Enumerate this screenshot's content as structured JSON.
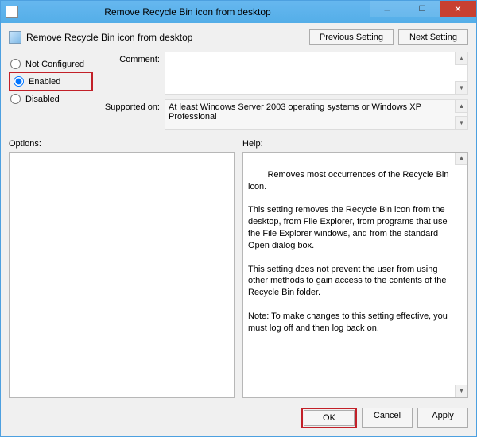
{
  "window": {
    "title": "Remove Recycle Bin icon from desktop"
  },
  "header": {
    "policy_name": "Remove Recycle Bin icon from desktop",
    "prev_btn": "Previous Setting",
    "next_btn": "Next Setting"
  },
  "radios": {
    "not_configured": "Not Configured",
    "enabled": "Enabled",
    "disabled": "Disabled",
    "selected": "enabled"
  },
  "fields": {
    "comment_label": "Comment:",
    "comment_value": "",
    "supported_label": "Supported on:",
    "supported_value": "At least Windows Server 2003 operating systems or Windows XP Professional"
  },
  "lower": {
    "options_label": "Options:",
    "options_text": "",
    "help_label": "Help:",
    "help_text": "Removes most occurrences of the Recycle Bin icon.\n\nThis setting removes the Recycle Bin icon from the desktop, from File Explorer, from programs that use the File Explorer windows, and from the standard Open dialog box.\n\nThis setting does not prevent the user from using other methods to gain access to the contents of the Recycle Bin folder.\n\nNote: To make changes to this setting effective, you must log off and then log back on."
  },
  "footer": {
    "ok": "OK",
    "cancel": "Cancel",
    "apply": "Apply"
  }
}
